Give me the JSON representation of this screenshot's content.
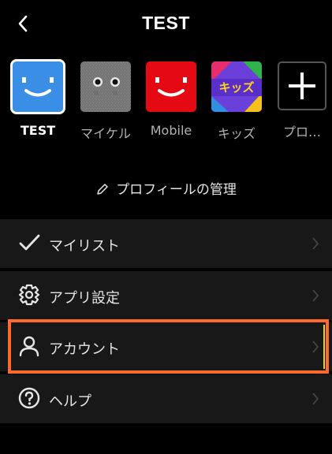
{
  "header": {
    "title": "TEST",
    "back_icon": "chevron-left-icon"
  },
  "profiles": [
    {
      "name": "TEST",
      "icon": "smiley-blue-avatar",
      "color": "#3a8ee6",
      "selected": true
    },
    {
      "name": "マイケル",
      "icon": "fluffy-monster-avatar",
      "color": "#777777",
      "selected": false
    },
    {
      "name": "Mobile",
      "icon": "smiley-red-avatar",
      "color": "#e50914",
      "selected": false
    },
    {
      "name": "キッズ",
      "icon": "kids-avatar",
      "color": "#6b3fd9",
      "selected": false
    },
    {
      "name": "プロ…",
      "icon": "plus-icon",
      "color": "#000000",
      "selected": false
    }
  ],
  "kids_avatar_text": "キッズ",
  "manage_profiles": {
    "label": "プロフィールの管理",
    "icon": "pencil-icon"
  },
  "menu": [
    {
      "label": "マイリスト",
      "icon": "checkmark-icon"
    },
    {
      "label": "アプリ設定",
      "icon": "gear-icon"
    },
    {
      "label": "アカウント",
      "icon": "person-icon",
      "highlighted": true
    },
    {
      "label": "ヘルプ",
      "icon": "help-icon"
    }
  ],
  "colors": {
    "background": "#000000",
    "menu_background": "#181818",
    "highlight_border": "#ff6a2b"
  }
}
